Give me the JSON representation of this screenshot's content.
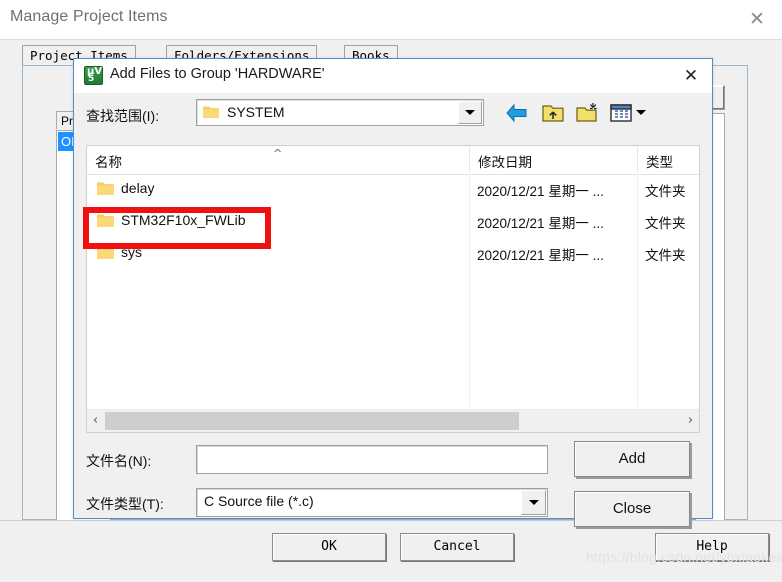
{
  "background_window": {
    "title": "Manage Project Items",
    "close_icon": "close-icon",
    "tabs": [
      {
        "label": "Project Items"
      },
      {
        "label": "Folders/Extensions"
      },
      {
        "label": "Books"
      }
    ],
    "list_header": "Proje",
    "selected_item": "OLED",
    "down_button_glyph": "↓",
    "footer_buttons": {
      "ok": "OK",
      "cancel": "Cancel",
      "help": "Help"
    },
    "watermark": "https://blog.csdn.net/ybxiaokeai"
  },
  "dialog": {
    "title": "Add Files to Group 'HARDWARE'",
    "icon": "uvision-icon",
    "close_icon": "close-icon",
    "look_in": {
      "label": "查找范围(I):",
      "value": "SYSTEM",
      "folder_icon": "folder-icon",
      "dropdown_icon": "chevron-down-icon"
    },
    "toolbar": {
      "back_icon": "back-arrow-icon",
      "up_icon": "up-folder-icon",
      "new_folder_icon": "new-folder-icon",
      "views_icon": "views-icon",
      "views_dropdown_icon": "chevron-down-icon"
    },
    "file_list": {
      "columns": [
        {
          "label": "名称"
        },
        {
          "label": "修改日期"
        },
        {
          "label": "类型"
        }
      ],
      "sort_caret": "^",
      "rows": [
        {
          "name": "delay",
          "date": "2020/12/21 星期一 ...",
          "type": "文件夹",
          "icon": "folder-icon"
        },
        {
          "name": "STM32F10x_FWLib",
          "date": "2020/12/21 星期一 ...",
          "type": "文件夹",
          "icon": "folder-icon"
        },
        {
          "name": "sys",
          "date": "2020/12/21 星期一 ...",
          "type": "文件夹",
          "icon": "folder-icon"
        }
      ],
      "scrollbar": {
        "left_arrow": "‹",
        "right_arrow": "›"
      }
    },
    "file_name": {
      "label": "文件名(N):",
      "value": "",
      "placeholder": ""
    },
    "file_type": {
      "label": "文件类型(T):",
      "value": "C Source file (*.c)",
      "dropdown_icon": "chevron-down-icon"
    },
    "buttons": {
      "add": "Add",
      "close": "Close"
    }
  },
  "annotation": {
    "highlight_color": "#f11010",
    "target": "STM32F10x_FWLib"
  }
}
